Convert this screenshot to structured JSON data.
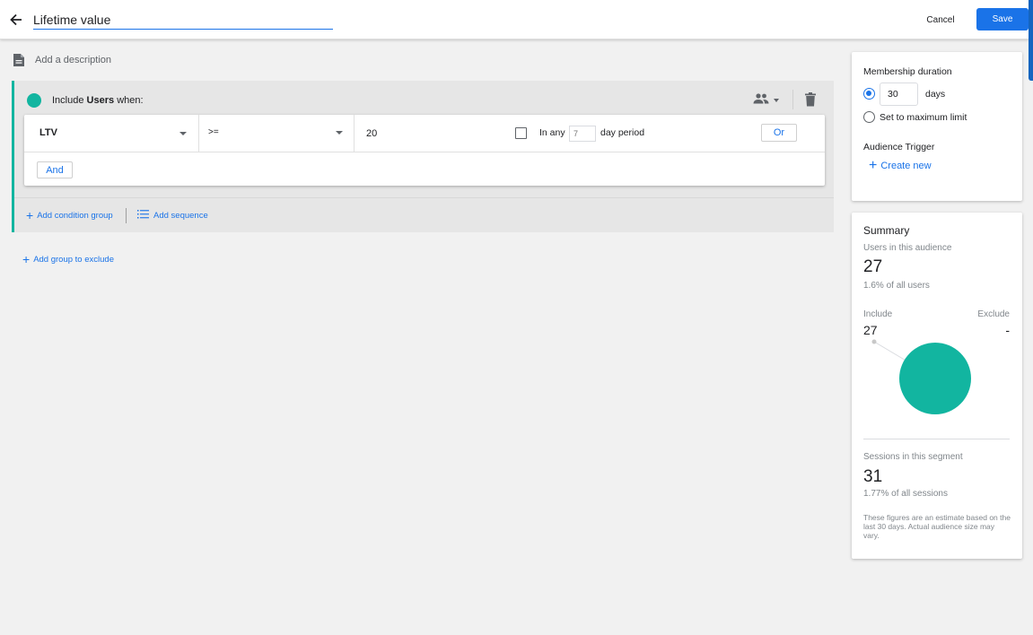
{
  "header": {
    "title_value": "Lifetime value",
    "cancel_label": "Cancel",
    "save_label": "Save"
  },
  "description": {
    "placeholder": "Add a description"
  },
  "include_group": {
    "prefix": "Include",
    "scope": "Users",
    "suffix": "when:",
    "condition": {
      "dimension": "LTV",
      "operator": ">=",
      "value": "20",
      "in_any_label": "In any",
      "days_placeholder": "7",
      "day_period_label": "day period",
      "or_label": "Or",
      "checked": false
    },
    "and_label": "And",
    "add_condition_group_label": "Add condition group",
    "add_sequence_label": "Add sequence"
  },
  "add_group_to_exclude_label": "Add group to exclude",
  "membership": {
    "title": "Membership duration",
    "duration_value": "30",
    "days_label": "days",
    "max_limit_label": "Set to maximum limit",
    "selected_option": "days",
    "trigger_title": "Audience Trigger",
    "create_new_label": "Create new"
  },
  "summary": {
    "title": "Summary",
    "users_label": "Users in this audience",
    "users_count": "27",
    "users_pct": "1.6% of all users",
    "include_label": "Include",
    "include_count": "27",
    "exclude_label": "Exclude",
    "exclude_count": "-",
    "sessions_label": "Sessions in this segment",
    "sessions_count": "31",
    "sessions_pct": "1.77% of all sessions",
    "footnote": "These figures are an estimate based on the last 30 days. Actual audience size may vary."
  },
  "colors": {
    "accent": "#1a73e8",
    "include_teal": "#12b5a0"
  },
  "icons": [
    "back-arrow-icon",
    "document-icon",
    "people-icon",
    "chevron-down-icon",
    "trash-icon",
    "plus-icon",
    "list-sequence-icon"
  ]
}
